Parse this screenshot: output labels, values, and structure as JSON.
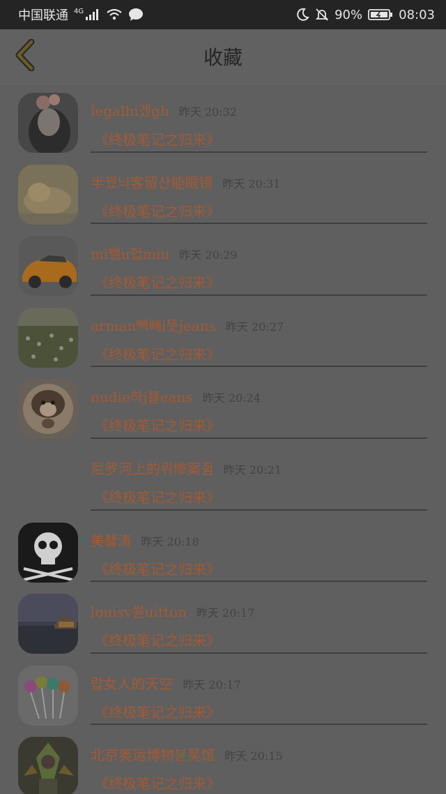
{
  "status_bar": {
    "carrier": "中国联通",
    "network": "4G",
    "battery": "90%",
    "time": "08:03"
  },
  "header": {
    "title": "收藏"
  },
  "favorites": [
    {
      "name": "legalhi겠gh",
      "time": "昨天 20:32",
      "book": "《终极笔记之归来》",
      "avatar": "girl-photo"
    },
    {
      "name": "半꿨늬客留산能眼镜",
      "time": "昨天 20:31",
      "book": "《终极笔记之归来》",
      "avatar": "cat-photo"
    },
    {
      "name": "mi뺄u헙miu",
      "time": "昨天 20:29",
      "book": "《终极笔记之归来》",
      "avatar": "car-photo"
    },
    {
      "name": "arman빽뻬i뜻jeans",
      "time": "昨天 20:27",
      "book": "《终极笔记之归来》",
      "avatar": "flower-field-photo"
    },
    {
      "name": "nudie하j뷸eans",
      "time": "昨天 20:24",
      "book": "《终极笔记之归来》",
      "avatar": "dog-cartoon"
    },
    {
      "name": "尼罗河上的뤼惨案쥠",
      "time": "昨天 20:21",
      "book": "《终极笔记之归来》",
      "avatar": ""
    },
    {
      "name": "美쵏涛",
      "time": "昨天 20:18",
      "book": "《终极笔记之归来》",
      "avatar": "skull-crossbones"
    },
    {
      "name": "louisv쐳uitton",
      "time": "昨天 20:17",
      "book": "《终极笔记之归来》",
      "avatar": "lake-night-photo"
    },
    {
      "name": "랍女人的天空",
      "time": "昨天 20:17",
      "book": "《终极笔记之归来》",
      "avatar": "colorful-pens-photo"
    },
    {
      "name": "北京奥运博物뷴昊馆",
      "time": "昨天 20:15",
      "book": "《终极笔记之归来》",
      "avatar": "game-character"
    }
  ],
  "colors": {
    "accent": "#a35a34",
    "overlay_bg": "#5f5f5f",
    "status_bg": "#242424"
  }
}
